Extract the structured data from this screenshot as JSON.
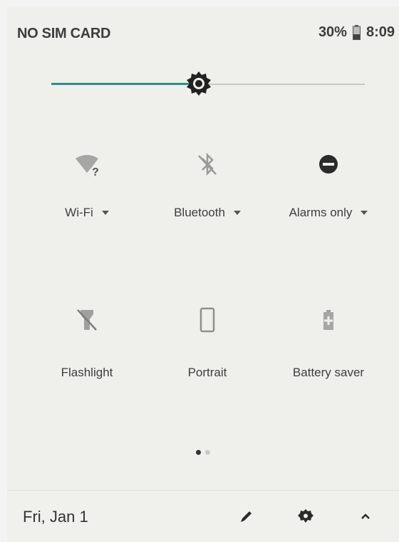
{
  "status_bar": {
    "carrier": "NO SIM CARD",
    "battery_percent": "30%",
    "time": "8:09",
    "battery_icon": "battery-icon"
  },
  "brightness": {
    "level": 0.47
  },
  "tiles": [
    {
      "label": "Wi-Fi",
      "icon": "wifi-unknown-icon",
      "has_dropdown": true
    },
    {
      "label": "Bluetooth",
      "icon": "bluetooth-off-icon",
      "has_dropdown": true
    },
    {
      "label": "Alarms only",
      "icon": "do-not-disturb-icon",
      "has_dropdown": true
    },
    {
      "label": "Flashlight",
      "icon": "flashlight-off-icon",
      "has_dropdown": false
    },
    {
      "label": "Portrait",
      "icon": "portrait-rotation-icon",
      "has_dropdown": false
    },
    {
      "label": "Battery saver",
      "icon": "battery-saver-icon",
      "has_dropdown": false
    }
  ],
  "pager": {
    "pages": 2,
    "current": 1
  },
  "footer": {
    "date": "Fri, Jan 1",
    "edit_icon": "pencil-icon",
    "settings_icon": "gear-icon",
    "collapse_icon": "chevron-up-icon"
  },
  "colors": {
    "accent": "#2f8f86",
    "icon_active": "#2b2b2b",
    "icon_inactive": "#9a9a98"
  }
}
